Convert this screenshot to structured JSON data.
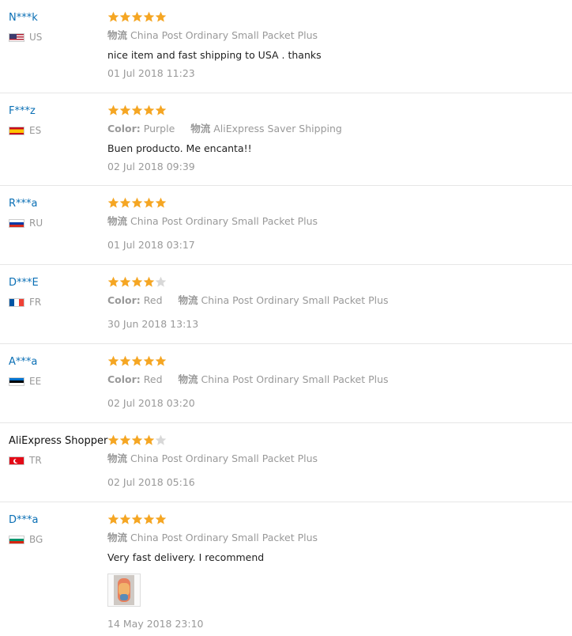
{
  "reviews": [
    {
      "user": "N***k",
      "country": "US",
      "rating": 5,
      "color_label": "",
      "color_value": "",
      "shipping_label": "物流",
      "shipping_value": "China Post Ordinary Small Packet Plus",
      "text": "nice item and fast shipping to USA . thanks",
      "date": "01 Jul 2018 11:23"
    },
    {
      "user": "F***z",
      "country": "ES",
      "rating": 5,
      "color_label": "Color:",
      "color_value": "Purple",
      "shipping_label": "物流",
      "shipping_value": "AliExpress Saver Shipping",
      "text": "Buen producto. Me encanta!!",
      "date": "02 Jul 2018 09:39"
    },
    {
      "user": "R***a",
      "country": "RU",
      "rating": 5,
      "color_label": "",
      "color_value": "",
      "shipping_label": "物流",
      "shipping_value": "China Post Ordinary Small Packet Plus",
      "text": "",
      "date": "01 Jul 2018 03:17"
    },
    {
      "user": "D***E",
      "country": "FR",
      "rating": 4,
      "color_label": "Color:",
      "color_value": "Red",
      "shipping_label": "物流",
      "shipping_value": "China Post Ordinary Small Packet Plus",
      "text": "",
      "date": "30 Jun 2018 13:13"
    },
    {
      "user": "A***a",
      "country": "EE",
      "rating": 5,
      "color_label": "Color:",
      "color_value": "Red",
      "shipping_label": "物流",
      "shipping_value": "China Post Ordinary Small Packet Plus",
      "text": "",
      "date": "02 Jul 2018 03:20"
    },
    {
      "user": "AliExpress Shopper",
      "country": "TR",
      "rating": 4,
      "color_label": "",
      "color_value": "",
      "shipping_label": "物流",
      "shipping_value": "China Post Ordinary Small Packet Plus",
      "text": "",
      "date": "02 Jul 2018 05:16"
    },
    {
      "user": "D***a",
      "country": "BG",
      "rating": 5,
      "color_label": "",
      "color_value": "",
      "shipping_label": "物流",
      "shipping_value": "China Post Ordinary Small Packet Plus",
      "text": "Very fast delivery. I recommend",
      "date": "14 May 2018 23:10"
    }
  ],
  "colors": {
    "star_filled": "#f5a623",
    "star_empty": "#d8d8d8",
    "user_link": "#0a6fb5",
    "muted": "#999999"
  }
}
